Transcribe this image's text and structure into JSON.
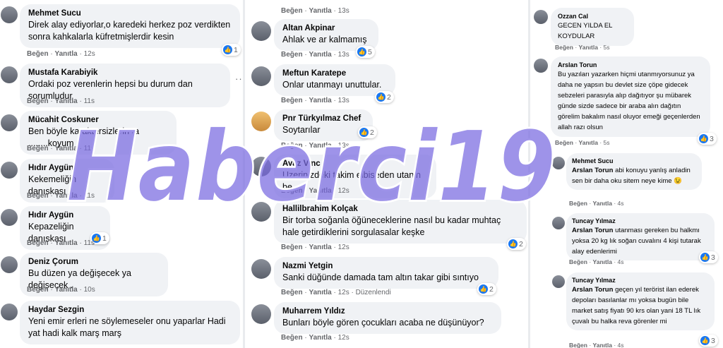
{
  "common": {
    "like": "Beğen",
    "reply": "Yanıtla",
    "sep": "·"
  },
  "col1": [
    {
      "name": "Mehmet Sucu",
      "text": "Direk alay ediyorlar,o karedeki herkez poz verdikten sonra kahkalarla küfretmişlerdir kesin",
      "time": "12s",
      "reactions": "1"
    },
    {
      "name": "Mustafa Karabiyik",
      "text": "Ordaki poz verenlerin hepsi bu durum dan sorumludur",
      "time": "11s",
      "reactions": ""
    },
    {
      "name": "Mücahit Coskuner",
      "text": "Ben böyle karaktersizlerin ta ........koyum",
      "time": "11s",
      "reactions": ""
    },
    {
      "name": "Hıdır Aygün",
      "text": "Kekemeliğin danıskası",
      "time": "11s",
      "reactions": ""
    },
    {
      "name": "Hıdır Aygün",
      "text": "Kepazeliğin danıskası",
      "time": "11s",
      "reactions": "1"
    },
    {
      "name": "Deniz Çorum",
      "text": "Bu düzen ya değişecek ya değişecek .",
      "time": "10s",
      "reactions": ""
    },
    {
      "name": "Haydar Sezgin",
      "text": "Yeni emir erleri ne söylemeseler onu yaparlar Hadi yat hadi kalk marş marş",
      "time": "",
      "reactions": ""
    }
  ],
  "col2_top_actions": {
    "time": "13s"
  },
  "col2": [
    {
      "name": "Altan Akpinar",
      "text": "Ahlak ve ar kalmamış",
      "time": "13s",
      "reactions": "5"
    },
    {
      "name": "Meftun Karatepe",
      "text": "Onlar utanmayı unuttular.",
      "time": "13s",
      "reactions": "2"
    },
    {
      "name": "Pnr Türkyılmaz Chef",
      "text": "Soytarılar",
      "time": "13s",
      "reactions": "2"
    },
    {
      "name": "Ayaz Vinc",
      "text": "Uzerinizdeki takim elbiseden utanin be",
      "time": "12s",
      "reactions": ""
    },
    {
      "name": "Hallilbrahim Kolçak",
      "text": "Bir torba soğanla öğüneceklerine nasıl bu kadar muhtaç hale getirdiklerini sorgulasalar keşke",
      "time": "12s",
      "reactions": "2"
    },
    {
      "name": "Nazmi Yetgin",
      "text": "Sanki düğünde damada tam altın takar gibi sıntıyo",
      "time": "12s",
      "edited": "Düzenlendi",
      "reactions": "2"
    },
    {
      "name": "Muharrem Yıldız",
      "text": "Bunları böyle gören çocukları acaba ne düşünüyor?",
      "time": "12s",
      "reactions": ""
    }
  ],
  "col3": [
    {
      "name": "Ozzan Cal",
      "text": "GECEN YILDA EL KOYDULAR",
      "time": "5s",
      "reactions": ""
    },
    {
      "name": "Arslan Torun",
      "text": "Bu yazıları yazarken hiçmi utanmıyorsunuz ya daha ne yapsın bu devlet size çöpe gidecek sebzeleri parasıyla alıp dağıtıyor şu mübarek günde sizde sadece bir araba alın dağıtın görelim bakalım nasıl oluyor emeği geçenlerden allah razı olsun",
      "time": "5s",
      "reactions": "3"
    },
    {
      "name": "Mehmet Sucu",
      "mention": "Arslan Torun",
      "text": "abi konuyu yanlış anladin sen bir daha oku sitem neye kime 😉",
      "time": "4s",
      "reactions": ""
    },
    {
      "name": "Tuncay Yılmaz",
      "mention": "Arslan Torun",
      "text": "utanması gereken bu halkmı yoksa 20 kg lık soğan cuvalını 4 kişi tutarak alay edenlerimi",
      "time": "4s",
      "reactions": "3"
    },
    {
      "name": "Tuncay Yılmaz",
      "mention": "Arslan Torun",
      "text": "geçen yıl terörist ilan ederek depoları basılanlar mı yoksa bugün bile market satış fiyatı 90 krs olan yani 18 TL lık çuvalı bu halka reva görenler mi",
      "time": "4s",
      "reactions": "3"
    }
  ],
  "watermark": "Haberci19"
}
